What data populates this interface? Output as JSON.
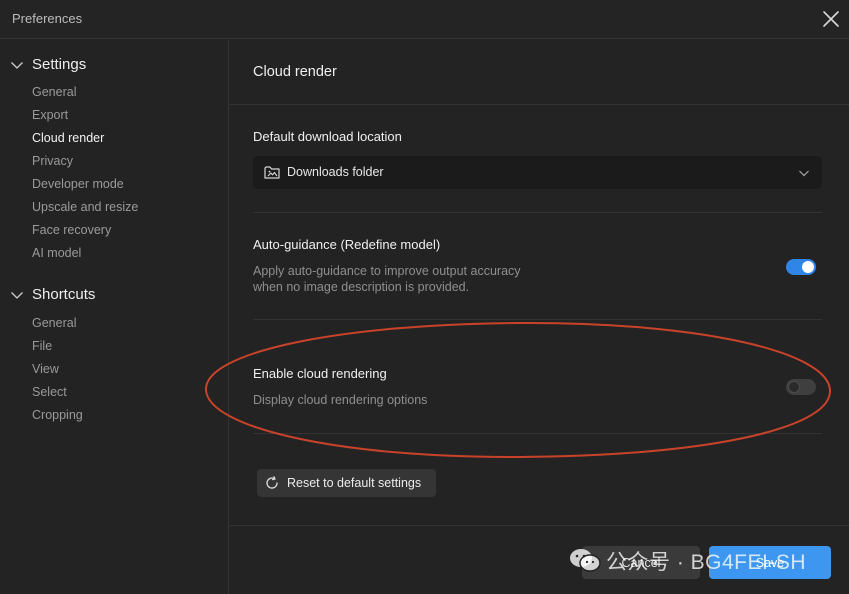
{
  "window": {
    "title": "Preferences"
  },
  "sidebar": {
    "groups": [
      {
        "label": "Settings",
        "items": [
          {
            "label": "General"
          },
          {
            "label": "Export"
          },
          {
            "label": "Cloud render"
          },
          {
            "label": "Privacy"
          },
          {
            "label": "Developer mode"
          },
          {
            "label": "Upscale and resize"
          },
          {
            "label": "Face recovery"
          },
          {
            "label": "AI model"
          }
        ]
      },
      {
        "label": "Shortcuts",
        "items": [
          {
            "label": "General"
          },
          {
            "label": "File"
          },
          {
            "label": "View"
          },
          {
            "label": "Select"
          },
          {
            "label": "Cropping"
          }
        ]
      }
    ],
    "active_item": "Cloud render"
  },
  "main": {
    "section_title": "Cloud render",
    "download_location": {
      "label": "Default download location",
      "value": "Downloads folder"
    },
    "auto_guidance": {
      "label": "Auto-guidance (Redefine model)",
      "description": "Apply auto-guidance to improve output accuracy when no image description is provided.",
      "enabled": true
    },
    "cloud_rendering": {
      "label": "Enable cloud rendering",
      "description": "Display cloud rendering options",
      "enabled": false
    },
    "reset_label": "Reset to default settings"
  },
  "footer": {
    "cancel_label": "Cancel",
    "save_label": "Save"
  },
  "watermark": {
    "text": "公众号 · BG4FEI-SH"
  },
  "colors": {
    "accent": "#3d97f0",
    "toggle_on": "#2f86e6",
    "annotation": "#c8432a"
  }
}
